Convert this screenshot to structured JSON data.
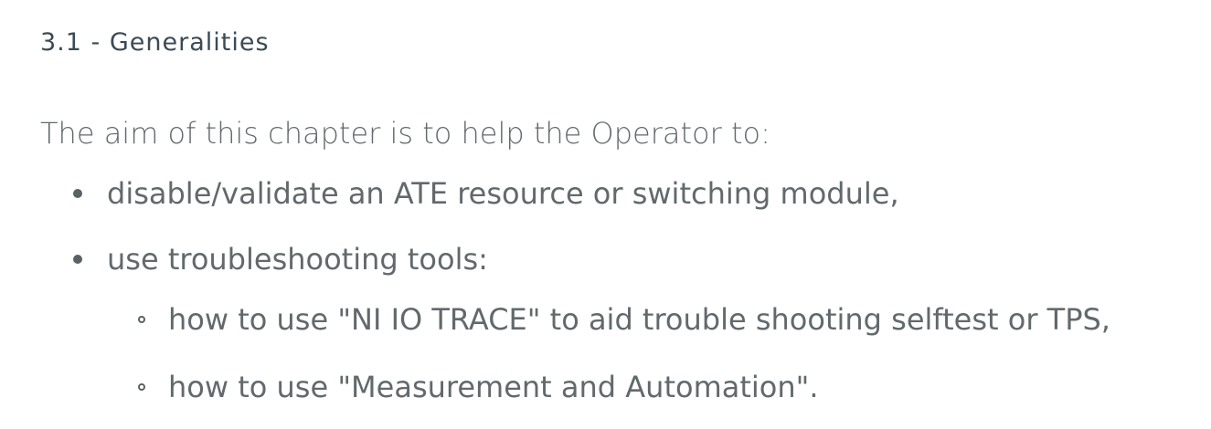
{
  "section": {
    "heading": "3.1 - Generalities"
  },
  "content": {
    "intro": "The aim of this chapter is to help the Operator to:",
    "list": [
      {
        "text": "disable/validate an ATE resource or switching module,",
        "bullet": "disc-icon"
      },
      {
        "text": "use troubleshooting tools:",
        "bullet": "disc-icon",
        "sublist": [
          {
            "text": "how to use \"NI IO TRACE\" to aid trouble shooting selftest or TPS,",
            "bullet": "circle-icon"
          },
          {
            "text": "how to use \"Measurement and Automation\".",
            "bullet": "circle-icon"
          }
        ]
      }
    ]
  },
  "colors": {
    "heading": "#3b4a55",
    "body_text": "#62696d",
    "background": "#ffffff"
  }
}
